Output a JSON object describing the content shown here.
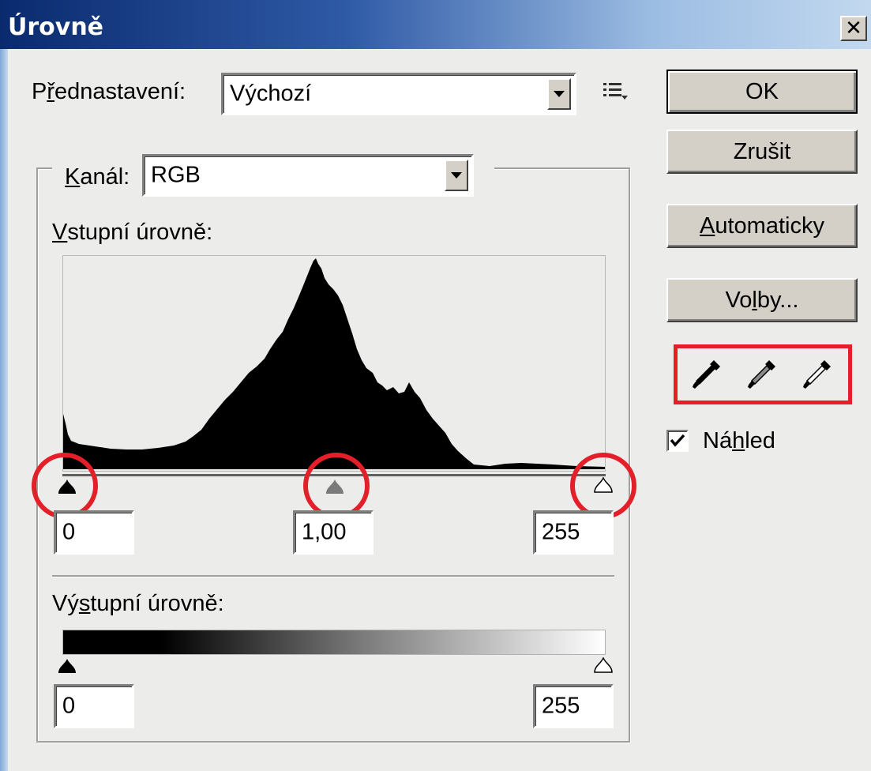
{
  "window": {
    "title": "Úrovně",
    "close_label": "✕"
  },
  "preset": {
    "label_pre": "P",
    "label_u": "ř",
    "label_post": "ednastavení:",
    "value": "Výchozí"
  },
  "channel": {
    "label_u": "K",
    "label_post": "anál:",
    "value": "RGB"
  },
  "input_levels": {
    "label_u": "V",
    "label_post": "stupní úrovně:",
    "black_value": "0",
    "gamma_value": "1,00",
    "white_value": "255"
  },
  "output_levels": {
    "label_pre": "Vý",
    "label_u": "s",
    "label_post": "tupní úrovně:",
    "black_value": "0",
    "white_value": "255"
  },
  "buttons": {
    "ok": "OK",
    "cancel": "Zrušit",
    "auto_u": "A",
    "auto_post": "utomaticky",
    "options_pre": "Vo",
    "options_u": "l",
    "options_post": "by..."
  },
  "preview": {
    "label_pre": "Ná",
    "label_u": "h",
    "label_post": "led",
    "checked": true
  },
  "icons": [
    "close-icon",
    "dropdown-arrow-icon",
    "presets-menu-icon",
    "black-eyedropper-icon",
    "gray-eyedropper-icon",
    "white-eyedropper-icon",
    "checkmark-icon"
  ],
  "colors": {
    "highlight": "#e3202a",
    "title_bar_start": "#0a2a6e",
    "title_bar_end": "#c2d8ef"
  }
}
